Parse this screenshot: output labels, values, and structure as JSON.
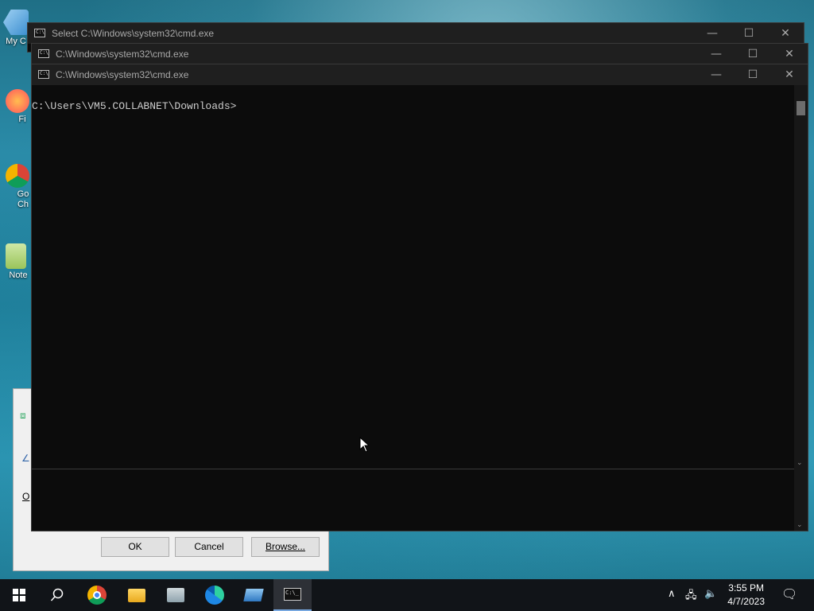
{
  "desktop": {
    "icons": [
      {
        "label": "My C",
        "name": "my-computer"
      },
      {
        "label": "Fi",
        "name": "firefox"
      },
      {
        "label": "Go\nCh",
        "name": "google-chrome"
      },
      {
        "label": "Note",
        "name": "notepad"
      }
    ]
  },
  "dialog": {
    "ok_label": "OK",
    "cancel_label": "Cancel",
    "browse_label": "Browse...",
    "partial_label": "O"
  },
  "windows": [
    {
      "title": "Select C:\\Windows\\system32\\cmd.exe"
    },
    {
      "title": "C:\\Windows\\system32\\cmd.exe"
    },
    {
      "title": "C:\\Windows\\system32\\cmd.exe"
    }
  ],
  "console": {
    "prompt": "C:\\Users\\VM5.COLLABNET\\Downloads>"
  },
  "window_controls": {
    "minimize": "—",
    "maximize": "☐",
    "close": "✕"
  },
  "taskbar": {
    "items": [
      "start",
      "search",
      "chrome",
      "file-explorer",
      "control-panel",
      "edge",
      "remote-desktop",
      "cmd"
    ],
    "time": "3:55 PM",
    "date": "4/7/2023"
  },
  "colors": {
    "console_bg": "#0c0c0c",
    "console_text": "#cccccc",
    "titlebar": "#1f1f1f",
    "taskbar": "#111418"
  }
}
